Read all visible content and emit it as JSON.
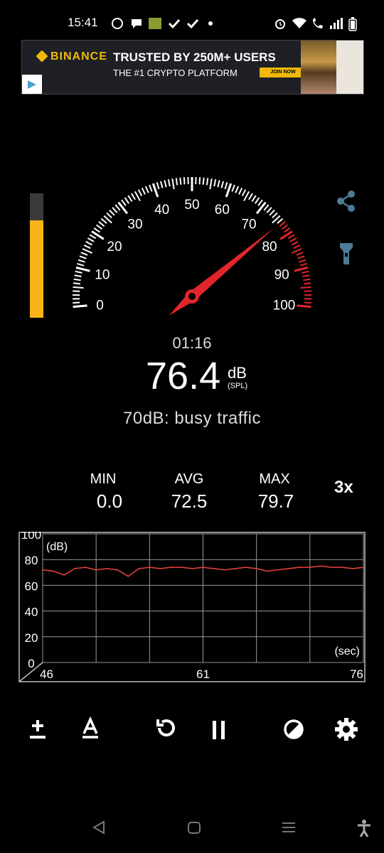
{
  "status_bar": {
    "time": "15:41",
    "icons": [
      "whatsapp-icon",
      "chat-icon",
      "app-badge-icon",
      "check-icon",
      "check-icon",
      "dot-icon",
      "alarm-icon",
      "wifi-icon",
      "wifi-call-icon",
      "signal-icon",
      "battery-icon"
    ]
  },
  "ad": {
    "brand": "BINANCE",
    "headline": "TRUSTED BY 250M+ USERS",
    "subline": "THE #1 CRYPTO PLATFORM",
    "cta": "JOIN NOW",
    "brand_color": "#f0b90b"
  },
  "meter": {
    "level_fraction": 0.78,
    "gauge_ticks": [
      "0",
      "10",
      "20",
      "30",
      "40",
      "50",
      "60",
      "70",
      "80",
      "90",
      "100"
    ],
    "gauge_value": 76.4,
    "timer": "01:16",
    "reading": "76.4",
    "unit": "dB",
    "unit_sub": "(SPL)",
    "description": "70dB: busy traffic",
    "accent": "#f7b417",
    "needle_color": "#e0262a"
  },
  "stats": {
    "min_label": "MIN",
    "min_value": "0.0",
    "avg_label": "AVG",
    "avg_value": "72.5",
    "max_label": "MAX",
    "max_value": "79.7",
    "speed": "3x"
  },
  "graph": {
    "y_unit": "(dB)",
    "x_unit": "(sec)",
    "y_ticks": [
      "0",
      "20",
      "40",
      "60",
      "80",
      "100"
    ],
    "x_ticks": [
      "46",
      "61",
      "76"
    ],
    "line_color": "#e8453c"
  },
  "chart_data": {
    "type": "line",
    "x": [
      46,
      47,
      48,
      49,
      50,
      51,
      52,
      53,
      54,
      55,
      56,
      57,
      58,
      59,
      60,
      61,
      62,
      63,
      64,
      65,
      66,
      67,
      68,
      69,
      70,
      71,
      72,
      73,
      74,
      75,
      76
    ],
    "series": [
      {
        "values": [
          72,
          71,
          68,
          73,
          74,
          72,
          73,
          72,
          67,
          73,
          74,
          73,
          74,
          74,
          73,
          74,
          73,
          72,
          73,
          74,
          73,
          71,
          72,
          73,
          74,
          74,
          75,
          74,
          74,
          73,
          74
        ]
      }
    ],
    "ylim": [
      0,
      100
    ],
    "xlim": [
      46,
      76
    ],
    "grid": true
  },
  "toolbar": {
    "buttons": [
      "calibrate-icon",
      "weighting-icon",
      "reset-icon",
      "pause-icon",
      "theme-icon",
      "settings-icon"
    ]
  },
  "nav_bar": {
    "buttons": [
      "back-icon",
      "home-icon",
      "recents-icon",
      "accessibility-icon"
    ]
  }
}
